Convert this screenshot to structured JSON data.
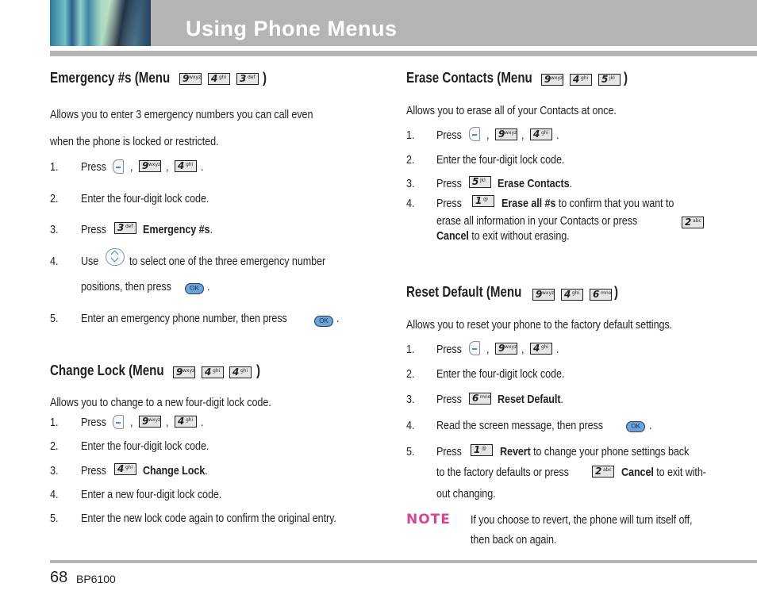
{
  "header": {
    "title": "Using Phone Menus"
  },
  "footer": {
    "page_number": "68",
    "model": "BP6100"
  },
  "keys": {
    "k9": {
      "digit": "9",
      "letters": "wxyz"
    },
    "k4": {
      "digit": "4",
      "letters": "ghi"
    },
    "k3": {
      "digit": "3",
      "letters": "def"
    },
    "k5": {
      "digit": "5",
      "letters": "jkl"
    },
    "k6": {
      "digit": "6",
      "letters": "mno"
    },
    "k2": {
      "digit": "2",
      "letters": "abc"
    },
    "k1": {
      "digit": "1",
      "letters": "@"
    },
    "ok": "OK"
  },
  "emergency": {
    "heading": "Emergency #s (Menu",
    "close": ")",
    "intro1": "Allows you to enter 3 emergency numbers you can call even",
    "intro2": "when the phone is locked or restricted.",
    "steps": [
      {
        "n": "1.",
        "a": "Press",
        "sep1": ",",
        "sep2": ",",
        "end": "."
      },
      {
        "n": "2.",
        "a": "Enter the four-digit lock code."
      },
      {
        "n": "3.",
        "a": "Press",
        "bold": "Emergency #s",
        "end": "."
      },
      {
        "n": "4.",
        "a": "Use",
        "b": "to select one of the three emergency number",
        "c": "positions, then press",
        "end": "."
      },
      {
        "n": "5.",
        "a": "Enter an emergency phone number, then press",
        "end": "."
      }
    ]
  },
  "change_lock": {
    "heading": "Change Lock (Menu",
    "close": ")",
    "intro": "Allows you to change to a new four-digit lock code.",
    "steps": [
      {
        "n": "1.",
        "a": "Press",
        "sep1": ",",
        "sep2": ",",
        "end": "."
      },
      {
        "n": "2.",
        "a": "Enter the four-digit lock code."
      },
      {
        "n": "3.",
        "a": "Press",
        "bold": "Change Lock",
        "end": "."
      },
      {
        "n": "4.",
        "a": "Enter a new four-digit lock code."
      },
      {
        "n": "5.",
        "a": "Enter the new lock code again to confirm the original entry."
      }
    ]
  },
  "erase": {
    "heading": "Erase Contacts (Menu",
    "close": ")",
    "intro": "Allows you to erase all of your Contacts at once.",
    "steps": [
      {
        "n": "1.",
        "a": "Press",
        "sep1": ",",
        "sep2": ",",
        "end": "."
      },
      {
        "n": "2.",
        "a": "Enter the four-digit lock code."
      },
      {
        "n": "3.",
        "a": "Press",
        "bold": "Erase Contacts",
        "end": "."
      },
      {
        "n": "4.",
        "a": "Press",
        "bold": "Erase all #s",
        "b": "to confirm that you want to",
        "c": "erase all information in your Contacts or press",
        "bold2": "Cancel",
        "d": "to exit without erasing."
      }
    ]
  },
  "reset": {
    "heading": "Reset Default (Menu",
    "close": ")",
    "intro": "Allows you to reset your phone to the factory default settings.",
    "steps": [
      {
        "n": "1.",
        "a": "Press",
        "sep1": ",",
        "sep2": ",",
        "end": "."
      },
      {
        "n": "2.",
        "a": "Enter the four-digit lock code."
      },
      {
        "n": "3.",
        "a": "Press",
        "bold": "Reset Default",
        "end": "."
      },
      {
        "n": "4.",
        "a": "Read the screen message, then press",
        "end": "."
      },
      {
        "n": "5.",
        "a": "Press",
        "bold": "Revert",
        "b": "to change your phone settings back",
        "c": "to the factory defaults or press",
        "bold2": "Cancel",
        "d": "to exit with-",
        "e": "out changing."
      }
    ]
  },
  "note": {
    "label": "NOTE",
    "line1": "If you choose to revert, the phone will turn itself off,",
    "line2": "then back on again."
  }
}
